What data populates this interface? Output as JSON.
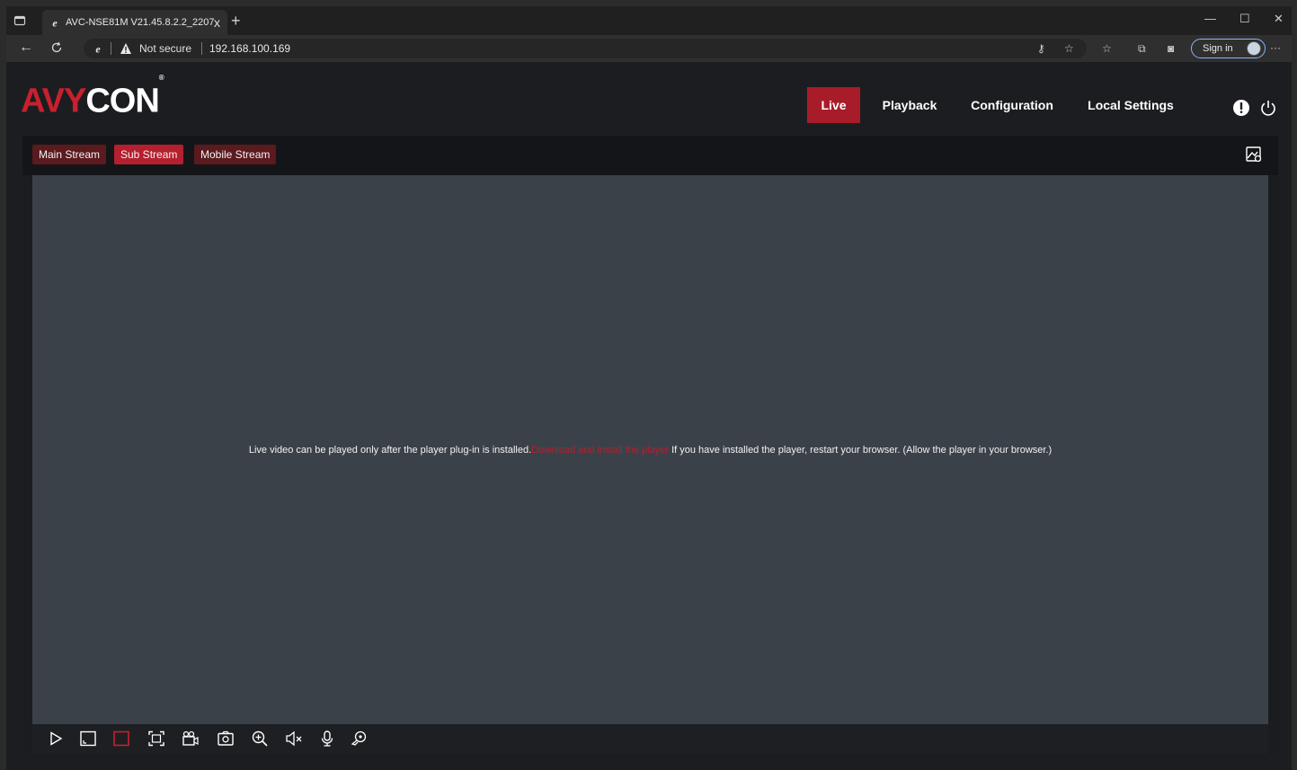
{
  "browser": {
    "tab_title": "AVC-NSE81M V21.45.8.2.2_2207",
    "new_tab": "+",
    "tab_close": "x",
    "not_secure": "Not secure",
    "url": "192.168.100.169",
    "sign_in": "Sign in",
    "more": "···",
    "minimize": "—",
    "maximize": "☐",
    "close": "✕"
  },
  "app": {
    "logo_main": "CON",
    "logo_red": "AVY",
    "logo_mark": "®"
  },
  "nav": {
    "items": [
      {
        "label": "Live",
        "active": true
      },
      {
        "label": "Playback",
        "active": false
      },
      {
        "label": "Configuration",
        "active": false
      },
      {
        "label": "Local Settings",
        "active": false
      }
    ]
  },
  "streams": {
    "items": [
      {
        "label": "Main Stream",
        "active": false
      },
      {
        "label": "Sub Stream",
        "active": true
      },
      {
        "label": "Mobile Stream",
        "active": false
      }
    ]
  },
  "player": {
    "message_before": "Live video can be played only after the player plug-in is installed.",
    "message_link": "Download and install the player",
    "message_after": " If you have installed the player, restart your browser. (Allow the player in your browser.)"
  },
  "toolbar": {
    "icons": [
      "play-icon",
      "window-icon",
      "record-box-icon",
      "fullscreen-icon",
      "video-record-icon",
      "snapshot-icon",
      "zoom-in-icon",
      "mute-icon",
      "microphone-icon",
      "view-3d-icon"
    ]
  },
  "colors": {
    "accent": "#a81c2a",
    "stream_btn": "#5a1a1e",
    "player_bg": "#3b4149"
  }
}
